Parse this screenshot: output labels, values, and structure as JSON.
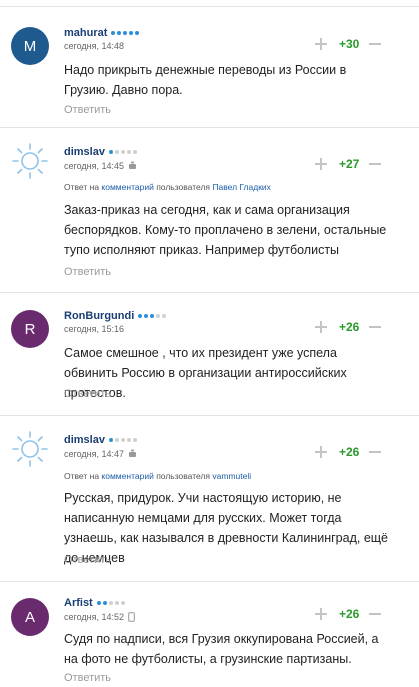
{
  "comments": [
    {
      "author": "mahurat",
      "time": "сегодня, 14:48",
      "avatar_letter": "M",
      "avatar_color": "#1f5a8f",
      "rating_dots": 5,
      "rating_on": 5,
      "score": "+30",
      "text": "Надо прикрыть денежные переводы из России в Грузию. Давно пора.",
      "reply_label": "Ответить"
    },
    {
      "author": "dimslav",
      "time": "сегодня, 14:45",
      "avatar_icon": "sun-icon",
      "device_icon": "android-icon",
      "rating_dots": 5,
      "rating_on": 1,
      "score": "+27",
      "reply_prefix": "Ответ на",
      "reply_link": "комментарий",
      "reply_mid": "пользователя",
      "reply_user": "Павел Гладких",
      "text": "Заказ-приказ на сегодня, как и сама организация беспорядков. Кому-то проплачено в зелени, остальные тупо исполняют приказ. Например футболисты",
      "reply_label": "Ответить"
    },
    {
      "author": "RonBurgundi",
      "time": "сегодня, 15:16",
      "avatar_letter": "R",
      "avatar_color": "#6a2b6e",
      "rating_dots": 5,
      "rating_on": 3,
      "score": "+26",
      "text": "Самое смешное , что их президент уже успела обвинить Россию в организации антироссийских протестов.",
      "reply_label": "Ответить"
    },
    {
      "author": "dimslav",
      "time": "сегодня, 14:47",
      "avatar_icon": "sun-icon",
      "device_icon": "android-icon",
      "rating_dots": 5,
      "rating_on": 1,
      "score": "+26",
      "reply_prefix": "Ответ на",
      "reply_link": "комментарий",
      "reply_mid": "пользователя",
      "reply_user": "vammuteli",
      "text": "Русская, придурок. Учи настоящую историю, не написанную немцами для русских. Может тогда узнаешь, как назывался в древности Калининград, ещё до немцев",
      "reply_label": "Ответить"
    },
    {
      "author": "Arfist",
      "time": "сегодня, 14:52",
      "avatar_letter": "A",
      "avatar_color": "#6a2b6e",
      "device_icon": "phone-icon",
      "rating_dots": 5,
      "rating_on": 2,
      "score": "+26",
      "text": "Судя по надписи, вся Грузия оккупирована Россией, а на фото не футболисты, а грузинские партизаны.",
      "reply_label": "Ответить"
    }
  ]
}
